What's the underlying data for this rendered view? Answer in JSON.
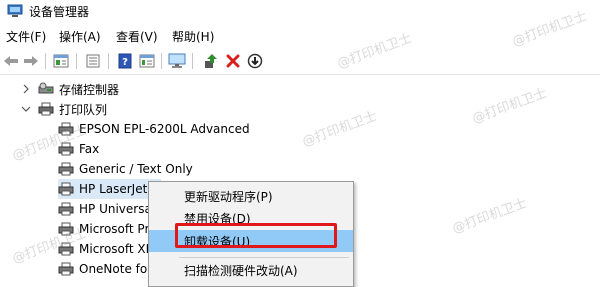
{
  "window": {
    "title": "设备管理器",
    "icon": "device-manager-icon"
  },
  "menubar": {
    "items": [
      "文件(F)",
      "操作(A)",
      "查看(V)",
      "帮助(H)"
    ]
  },
  "toolbar": {
    "buttons": [
      "back-arrow-icon",
      "forward-arrow-icon",
      "properties-icon",
      "device-list-icon",
      "help-icon",
      "view-icon",
      "monitor-icon",
      "update-driver-icon",
      "uninstall-icon",
      "disable-device-icon"
    ],
    "accent_red": "#d6201d",
    "accent_green": "#2f8f2f"
  },
  "tree": {
    "nodes": [
      {
        "label": "存储控制器",
        "expanded": false,
        "icon": "storage-controller-icon"
      },
      {
        "label": "打印队列",
        "expanded": true,
        "icon": "print-queue-icon"
      }
    ],
    "children": [
      {
        "label": "EPSON EPL-6200L Advanced"
      },
      {
        "label": "Fax"
      },
      {
        "label": "Generic / Text Only"
      },
      {
        "label": "HP LaserJet"
      },
      {
        "label": "HP Universa"
      },
      {
        "label": "Microsoft Pr"
      },
      {
        "label": "Microsoft XI"
      },
      {
        "label": "OneNote fo"
      }
    ],
    "selected_index": 3
  },
  "context_menu": {
    "items": [
      "更新驱动程序(P)",
      "禁用设备(D)",
      "卸载设备(U)",
      "扫描检测硬件改动(A)"
    ],
    "highlighted_index": 2,
    "highlight_color": "#91c9f7",
    "outline_color": "#e0181b"
  },
  "watermark": {
    "text": "@打印机卫士"
  }
}
